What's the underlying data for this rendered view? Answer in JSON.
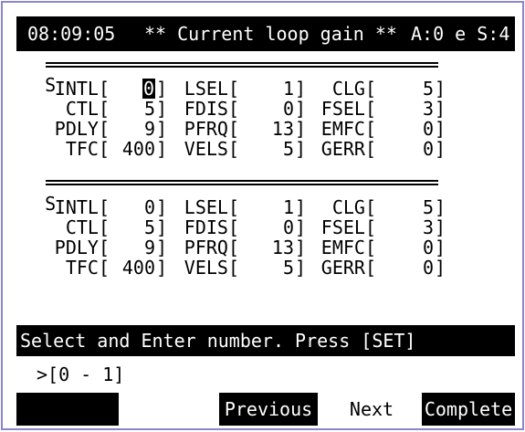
{
  "header": {
    "time": "08:09:05",
    "title": "** Current loop gain **",
    "status": "A:0 e S:4"
  },
  "sections": [
    {
      "label": "S",
      "rows": [
        {
          "l1": "INTL[",
          "v1": "0",
          "l2": "LSEL[",
          "v2": "1",
          "l3": "CLG[",
          "v3": "5"
        },
        {
          "l1": "CTL[",
          "v1": "5",
          "l2": "FDIS[",
          "v2": "0",
          "l3": "FSEL[",
          "v3": "3"
        },
        {
          "l1": "PDLY[",
          "v1": "9",
          "l2": "PFRQ[",
          "v2": "13",
          "l3": "EMFC[",
          "v3": "0"
        },
        {
          "l1": "TFC[",
          "v1": "400",
          "l2": "VELS[",
          "v2": "5",
          "l3": "GERR[",
          "v3": "0"
        }
      ]
    },
    {
      "label": "S",
      "rows": [
        {
          "l1": "INTL[",
          "v1": "0",
          "l2": "LSEL[",
          "v2": "1",
          "l3": "CLG[",
          "v3": "5"
        },
        {
          "l1": "CTL[",
          "v1": "5",
          "l2": "FDIS[",
          "v2": "0",
          "l3": "FSEL[",
          "v3": "3"
        },
        {
          "l1": "PDLY[",
          "v1": "9",
          "l2": "PFRQ[",
          "v2": "13",
          "l3": "EMFC[",
          "v3": "0"
        },
        {
          "l1": "TFC[",
          "v1": "400",
          "l2": "VELS[",
          "v2": "5",
          "l3": "GERR[",
          "v3": "0"
        }
      ]
    }
  ],
  "bracket_close": "]",
  "status_line": "Select and Enter number. Press [SET]",
  "prompt": ">[0 - 1]",
  "buttons": {
    "previous": "Previous",
    "next": "Next",
    "complete": "Complete"
  }
}
